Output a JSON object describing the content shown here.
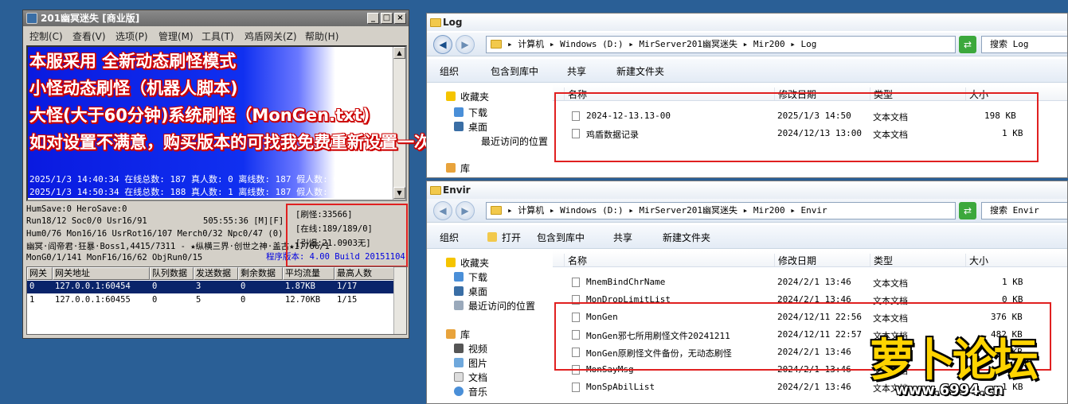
{
  "server": {
    "title": "201幽冥迷失 [商业版]",
    "menu": [
      "控制(C)",
      "查看(V)",
      "选项(P)",
      "管理(M)",
      "工具(T)",
      "鸡盾网关(Z)",
      "帮助(H)"
    ],
    "log_lines": [
      "2025/1/3 14:40:34 在线总数: 187 真人数: 0 离线数: 187 假人数: 0",
      "2025/1/3 14:50:34 在线总数: 188 真人数: 1 离线数: 187 假人数: 0"
    ],
    "banner_lines": [
      "本服采用 全新动态刷怪模式",
      "小怪动态刷怪（机器人脚本)",
      "大怪(大于60分钟)系统刷怪（MonGen.txt)",
      "如对设置不满意，购买版本的可找我免费重新设置一次"
    ],
    "status_lines": [
      "HumSave:0 HeroSave:0",
      "Run18/12 Soc0/0 Usr16/91",
      "Hum0/76 Mon16/16 UsrRot16/107 Merch0/32 Npc0/47 (0)",
      "幽冥·阎帝君·狂暴·Boss1,4415/7311 - ★纵横三界·创世之神·盖古★17766/1",
      "MonG0/1/141 MonF16/16/62 ObjRun0/15"
    ],
    "uptime": "505:55:36 [M][F]",
    "stats": {
      "refresh": "[刷怪:33566]",
      "online": "[在线:189/189/0]",
      "yinbao": "[引爆:21.0903无]"
    },
    "version": "程序版本: 4.00 Build 20151104",
    "gateway_table": {
      "headers": [
        "网关",
        "网关地址",
        "队列数据",
        "发送数据",
        "剩余数据",
        "平均流量",
        "最高人数"
      ],
      "rows": [
        [
          "0",
          "127.0.0.1:60454",
          "0",
          "3",
          "0",
          "1.87KB",
          "1/17"
        ],
        [
          "1",
          "127.0.0.1:60455",
          "0",
          "5",
          "0",
          "12.70KB",
          "1/15"
        ]
      ]
    }
  },
  "log_window": {
    "title": "Log",
    "address": [
      "计算机",
      "Windows (D:)",
      "MirServer201幽冥迷失",
      "Mir200",
      "Log"
    ],
    "search": "搜索 Log",
    "toolbar": [
      "组织",
      "包含到库中",
      "共享",
      "新建文件夹"
    ],
    "nav": [
      "收藏夹",
      "下载",
      "桌面",
      "最近访问的位置",
      "库"
    ],
    "columns": [
      "名称",
      "修改日期",
      "类型",
      "大小"
    ],
    "files": [
      {
        "name": "2024-12-13.13-00",
        "date": "2025/1/3 14:50",
        "type": "文本文档",
        "size": "198 KB"
      },
      {
        "name": "鸡盾数据记录",
        "date": "2024/12/13 13:00",
        "type": "文本文档",
        "size": "1 KB"
      }
    ]
  },
  "envir_window": {
    "title": "Envir",
    "address": [
      "计算机",
      "Windows (D:)",
      "MirServer201幽冥迷失",
      "Mir200",
      "Envir"
    ],
    "search": "搜索 Envir",
    "toolbar": [
      "组织",
      "打开",
      "包含到库中",
      "共享",
      "新建文件夹"
    ],
    "nav": [
      "收藏夹",
      "下载",
      "桌面",
      "最近访问的位置",
      "库",
      "视频",
      "图片",
      "文档",
      "音乐"
    ],
    "columns": [
      "名称",
      "修改日期",
      "类型",
      "大小"
    ],
    "files": [
      {
        "name": "MnemBindChrName",
        "date": "2024/2/1 13:46",
        "type": "文本文档",
        "size": "1 KB"
      },
      {
        "name": "MonDropLimitList",
        "date": "2024/2/1 13:46",
        "type": "文本文档",
        "size": "0 KB"
      },
      {
        "name": "MonGen",
        "date": "2024/12/11 22:56",
        "type": "文本文档",
        "size": "376 KB"
      },
      {
        "name": "MonGen邪七所用刷怪文件20241211",
        "date": "2024/12/11 22:57",
        "type": "文本文档",
        "size": "482 KB"
      },
      {
        "name": "MonGen原刷怪文件备份，无动态刷怪",
        "date": "2024/2/1 13:46",
        "type": "文本文档",
        "size": "376 KB"
      },
      {
        "name": "MonSayMsg",
        "date": "2024/2/1 13:46",
        "type": "文本文档",
        "size": "1 KB"
      },
      {
        "name": "MonSpAbilList",
        "date": "2024/2/1 13:46",
        "type": "文本文档",
        "size": "1 KB"
      }
    ]
  },
  "watermark": {
    "text": "萝卜论坛",
    "url": "www.6994.cn"
  }
}
